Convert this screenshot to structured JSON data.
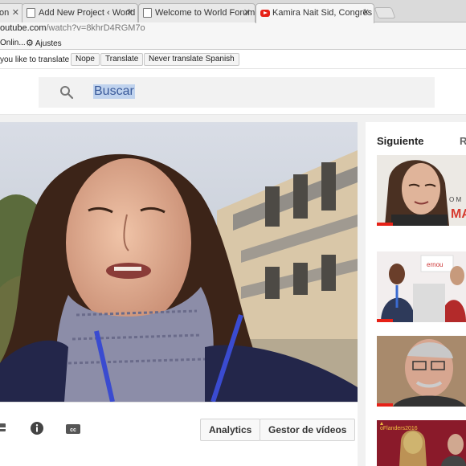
{
  "browser": {
    "tabs": [
      {
        "title": "on",
        "close": "✕"
      },
      {
        "title": "Add New Project ‹ World Forum on Local Economic Development",
        "close": "✕"
      },
      {
        "title": "Welcome to World Forum on Local Economic Development",
        "close": "✕"
      },
      {
        "title": "Kamira Nait Sid, Congrès Mondial",
        "close": "✕"
      }
    ],
    "url_domain": "outube.com",
    "url_path": "/watch?v=8khrD4RGM7o",
    "bookmarks": [
      "Onlin...",
      "Ajustes"
    ],
    "translate_bar": {
      "question": "you like to translate it?",
      "nope": "Nope",
      "translate": "Translate",
      "never": "Never translate Spanish"
    }
  },
  "youtube": {
    "search_text": "Buscar",
    "actions": {
      "analytics": "Analytics",
      "gestor": "Gestor de vídeos"
    },
    "sidebar": {
      "header": "Siguiente",
      "autoplay": "R",
      "thumbs": [
        {
          "overlay": "O M",
          "overlay2": "MA"
        },
        {
          "overlay": "ernou"
        },
        {
          "overlay": ""
        },
        {
          "overlay": "oFlanders2016"
        }
      ]
    },
    "colors": {
      "accent": "#e62117",
      "search_highlight": "#c0d3ee"
    }
  }
}
